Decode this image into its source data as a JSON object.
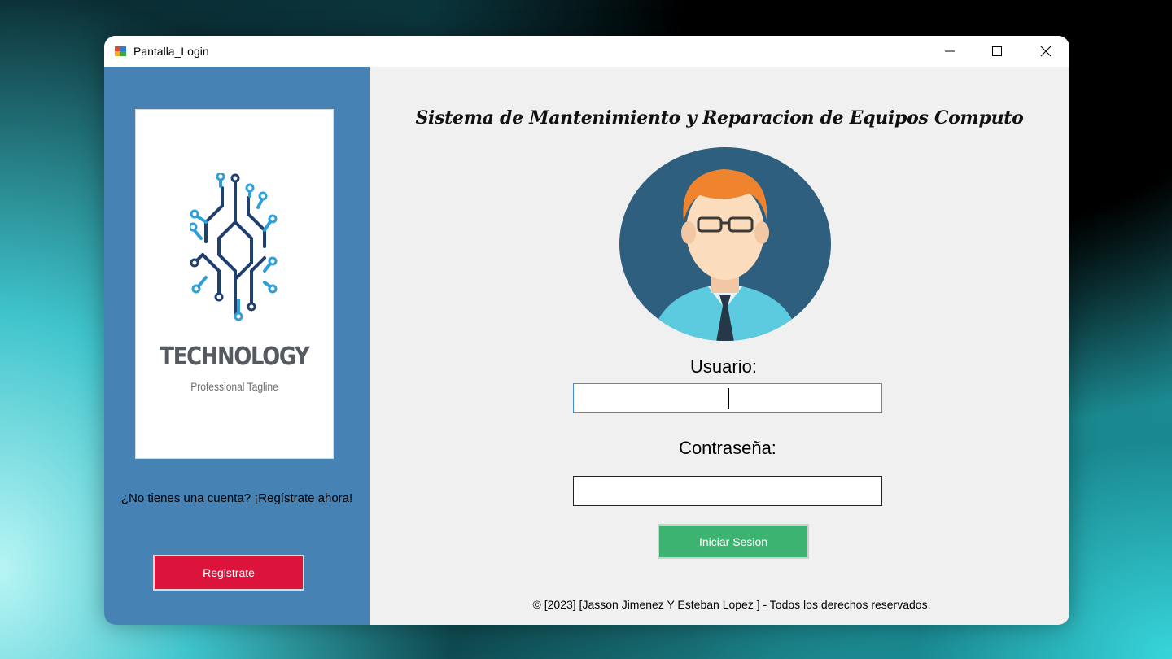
{
  "window": {
    "title": "Pantalla_Login",
    "controls": {
      "minimize": "minimize-icon",
      "maximize": "maximize-icon",
      "close": "close-icon"
    }
  },
  "sidebar": {
    "logo": {
      "name": "TECHNOLOGY",
      "tagline": "Professional Tagline"
    },
    "register_prompt": "¿No tienes una cuenta? ¡Regístrate ahora!",
    "register_button": "Registrate",
    "colors": {
      "background": "#4682b4",
      "register_button": "#dc143c"
    }
  },
  "main": {
    "title": "Sistema de Mantenimiento y Reparacion de Equipos Computo",
    "username_label": "Usuario:",
    "username_value": "",
    "password_label": "Contraseña:",
    "password_value": "",
    "login_button": "Iniciar Sesion",
    "copyright": "© [2023] [Jasson Jimenez Y Esteban Lopez ] - Todos los derechos reservados.",
    "colors": {
      "login_button": "#3cb371",
      "focus_border": "#3b8ee0"
    }
  }
}
